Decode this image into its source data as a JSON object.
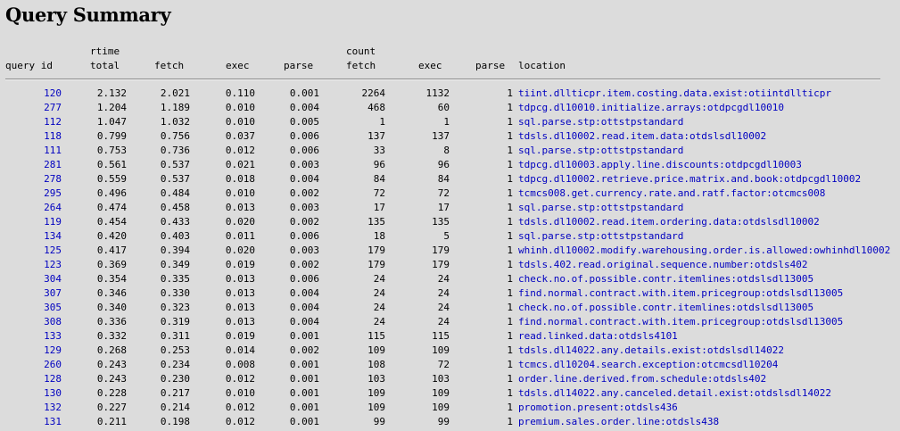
{
  "title": "Query Summary",
  "header": {
    "group_rtime": "rtime",
    "group_count": "count",
    "columns": [
      "query id",
      "total",
      "fetch",
      "exec",
      "parse",
      "fetch",
      "exec",
      "parse",
      "location"
    ]
  },
  "rows": [
    {
      "id": "120",
      "total": "2.132",
      "fetch": "2.021",
      "exec": "0.110",
      "parse": "0.001",
      "c_fetch": "2264",
      "c_exec": "1132",
      "c_parse": "1",
      "location": "tiint.dllticpr.item.costing.data.exist:otiintdllticpr"
    },
    {
      "id": "277",
      "total": "1.204",
      "fetch": "1.189",
      "exec": "0.010",
      "parse": "0.004",
      "c_fetch": "468",
      "c_exec": "60",
      "c_parse": "1",
      "location": "tdpcg.dl10010.initialize.arrays:otdpcgdl10010"
    },
    {
      "id": "112",
      "total": "1.047",
      "fetch": "1.032",
      "exec": "0.010",
      "parse": "0.005",
      "c_fetch": "1",
      "c_exec": "1",
      "c_parse": "1",
      "location": "sql.parse.stp:ottstpstandard"
    },
    {
      "id": "118",
      "total": "0.799",
      "fetch": "0.756",
      "exec": "0.037",
      "parse": "0.006",
      "c_fetch": "137",
      "c_exec": "137",
      "c_parse": "1",
      "location": "tdsls.dl10002.read.item.data:otdslsdl10002"
    },
    {
      "id": "111",
      "total": "0.753",
      "fetch": "0.736",
      "exec": "0.012",
      "parse": "0.006",
      "c_fetch": "33",
      "c_exec": "8",
      "c_parse": "1",
      "location": "sql.parse.stp:ottstpstandard"
    },
    {
      "id": "281",
      "total": "0.561",
      "fetch": "0.537",
      "exec": "0.021",
      "parse": "0.003",
      "c_fetch": "96",
      "c_exec": "96",
      "c_parse": "1",
      "location": "tdpcg.dl10003.apply.line.discounts:otdpcgdl10003"
    },
    {
      "id": "278",
      "total": "0.559",
      "fetch": "0.537",
      "exec": "0.018",
      "parse": "0.004",
      "c_fetch": "84",
      "c_exec": "84",
      "c_parse": "1",
      "location": "tdpcg.dl10002.retrieve.price.matrix.and.book:otdpcgdl10002"
    },
    {
      "id": "295",
      "total": "0.496",
      "fetch": "0.484",
      "exec": "0.010",
      "parse": "0.002",
      "c_fetch": "72",
      "c_exec": "72",
      "c_parse": "1",
      "location": "tcmcs008.get.currency.rate.and.ratf.factor:otcmcs008"
    },
    {
      "id": "264",
      "total": "0.474",
      "fetch": "0.458",
      "exec": "0.013",
      "parse": "0.003",
      "c_fetch": "17",
      "c_exec": "17",
      "c_parse": "1",
      "location": "sql.parse.stp:ottstpstandard"
    },
    {
      "id": "119",
      "total": "0.454",
      "fetch": "0.433",
      "exec": "0.020",
      "parse": "0.002",
      "c_fetch": "135",
      "c_exec": "135",
      "c_parse": "1",
      "location": "tdsls.dl10002.read.item.ordering.data:otdslsdl10002"
    },
    {
      "id": "134",
      "total": "0.420",
      "fetch": "0.403",
      "exec": "0.011",
      "parse": "0.006",
      "c_fetch": "18",
      "c_exec": "5",
      "c_parse": "1",
      "location": "sql.parse.stp:ottstpstandard"
    },
    {
      "id": "125",
      "total": "0.417",
      "fetch": "0.394",
      "exec": "0.020",
      "parse": "0.003",
      "c_fetch": "179",
      "c_exec": "179",
      "c_parse": "1",
      "location": "whinh.dl10002.modify.warehousing.order.is.allowed:owhinhdl10002"
    },
    {
      "id": "123",
      "total": "0.369",
      "fetch": "0.349",
      "exec": "0.019",
      "parse": "0.002",
      "c_fetch": "179",
      "c_exec": "179",
      "c_parse": "1",
      "location": "tdsls.402.read.original.sequence.number:otdsls402"
    },
    {
      "id": "304",
      "total": "0.354",
      "fetch": "0.335",
      "exec": "0.013",
      "parse": "0.006",
      "c_fetch": "24",
      "c_exec": "24",
      "c_parse": "1",
      "location": "check.no.of.possible.contr.itemlines:otdslsdl13005"
    },
    {
      "id": "307",
      "total": "0.346",
      "fetch": "0.330",
      "exec": "0.013",
      "parse": "0.004",
      "c_fetch": "24",
      "c_exec": "24",
      "c_parse": "1",
      "location": "find.normal.contract.with.item.pricegroup:otdslsdl13005"
    },
    {
      "id": "305",
      "total": "0.340",
      "fetch": "0.323",
      "exec": "0.013",
      "parse": "0.004",
      "c_fetch": "24",
      "c_exec": "24",
      "c_parse": "1",
      "location": "check.no.of.possible.contr.itemlines:otdslsdl13005"
    },
    {
      "id": "308",
      "total": "0.336",
      "fetch": "0.319",
      "exec": "0.013",
      "parse": "0.004",
      "c_fetch": "24",
      "c_exec": "24",
      "c_parse": "1",
      "location": "find.normal.contract.with.item.pricegroup:otdslsdl13005"
    },
    {
      "id": "133",
      "total": "0.332",
      "fetch": "0.311",
      "exec": "0.019",
      "parse": "0.001",
      "c_fetch": "115",
      "c_exec": "115",
      "c_parse": "1",
      "location": "read.linked.data:otdsls4101"
    },
    {
      "id": "129",
      "total": "0.268",
      "fetch": "0.253",
      "exec": "0.014",
      "parse": "0.002",
      "c_fetch": "109",
      "c_exec": "109",
      "c_parse": "1",
      "location": "tdsls.dl14022.any.details.exist:otdslsdl14022"
    },
    {
      "id": "260",
      "total": "0.243",
      "fetch": "0.234",
      "exec": "0.008",
      "parse": "0.001",
      "c_fetch": "108",
      "c_exec": "72",
      "c_parse": "1",
      "location": "tcmcs.dl10204.search.exception:otcmcsdl10204"
    },
    {
      "id": "128",
      "total": "0.243",
      "fetch": "0.230",
      "exec": "0.012",
      "parse": "0.001",
      "c_fetch": "103",
      "c_exec": "103",
      "c_parse": "1",
      "location": "order.line.derived.from.schedule:otdsls402"
    },
    {
      "id": "130",
      "total": "0.228",
      "fetch": "0.217",
      "exec": "0.010",
      "parse": "0.001",
      "c_fetch": "109",
      "c_exec": "109",
      "c_parse": "1",
      "location": "tdsls.dl14022.any.canceled.detail.exist:otdslsdl14022"
    },
    {
      "id": "132",
      "total": "0.227",
      "fetch": "0.214",
      "exec": "0.012",
      "parse": "0.001",
      "c_fetch": "109",
      "c_exec": "109",
      "c_parse": "1",
      "location": "promotion.present:otdsls436"
    },
    {
      "id": "131",
      "total": "0.211",
      "fetch": "0.198",
      "exec": "0.012",
      "parse": "0.001",
      "c_fetch": "99",
      "c_exec": "99",
      "c_parse": "1",
      "location": "premium.sales.order.line:otdsls438"
    }
  ]
}
